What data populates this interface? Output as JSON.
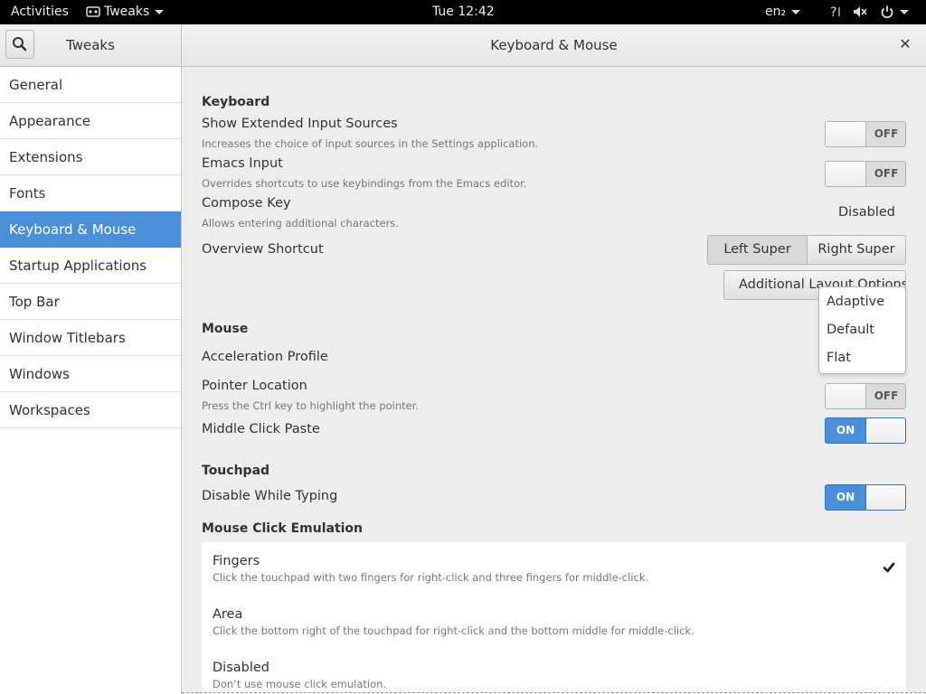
{
  "topbar": {
    "activities": "Activities",
    "app_menu": "Tweaks",
    "clock": "Tue 12:42",
    "keyboard_layout": "en₂"
  },
  "header": {
    "sidebar_title": "Tweaks",
    "title": "Keyboard & Mouse"
  },
  "sidebar": {
    "items": [
      {
        "label": "General"
      },
      {
        "label": "Appearance"
      },
      {
        "label": "Extensions"
      },
      {
        "label": "Fonts"
      },
      {
        "label": "Keyboard & Mouse",
        "active": true
      },
      {
        "label": "Startup Applications"
      },
      {
        "label": "Top Bar"
      },
      {
        "label": "Window Titlebars"
      },
      {
        "label": "Windows"
      },
      {
        "label": "Workspaces"
      }
    ]
  },
  "keyboard": {
    "heading": "Keyboard",
    "extended_sources": {
      "label": "Show Extended Input Sources",
      "desc": "Increases the choice of input sources in the Settings application.",
      "state": "OFF"
    },
    "emacs_input": {
      "label": "Emacs Input",
      "desc": "Overrides shortcuts to use keybindings from the Emacs editor.",
      "state": "OFF"
    },
    "compose_key": {
      "label": "Compose Key",
      "desc": "Allows entering additional characters.",
      "value": "Disabled"
    },
    "overview_shortcut": {
      "label": "Overview Shortcut",
      "options": [
        "Left Super",
        "Right Super"
      ]
    },
    "layout_options_button": "Additional Layout Options"
  },
  "mouse": {
    "heading": "Mouse",
    "acceleration_profile": {
      "label": "Acceleration Profile",
      "options": [
        "Adaptive",
        "Default",
        "Flat"
      ]
    },
    "pointer_location": {
      "label": "Pointer Location",
      "desc": "Press the Ctrl key to highlight the pointer.",
      "state": "OFF"
    },
    "middle_click_paste": {
      "label": "Middle Click Paste",
      "state": "ON"
    }
  },
  "touchpad": {
    "heading": "Touchpad",
    "disable_while_typing": {
      "label": "Disable While Typing",
      "state": "ON"
    },
    "click_emulation": {
      "heading": "Mouse Click Emulation",
      "selected": "Fingers",
      "options": [
        {
          "title": "Fingers",
          "desc": "Click the touchpad with two fingers for right-click and three fingers for middle-click."
        },
        {
          "title": "Area",
          "desc": "Click the bottom right of the touchpad for right-click and the bottom middle for middle-click."
        },
        {
          "title": "Disabled",
          "desc": "Don’t use mouse click emulation."
        }
      ]
    }
  },
  "colors": {
    "accent": "#4a90d9",
    "topbar": "#000000",
    "background": "#ededed"
  },
  "icons": [
    "search-icon",
    "close-icon",
    "accessibility-icon",
    "volume-muted-icon",
    "power-icon",
    "check-icon",
    "chevron-down-icon"
  ]
}
